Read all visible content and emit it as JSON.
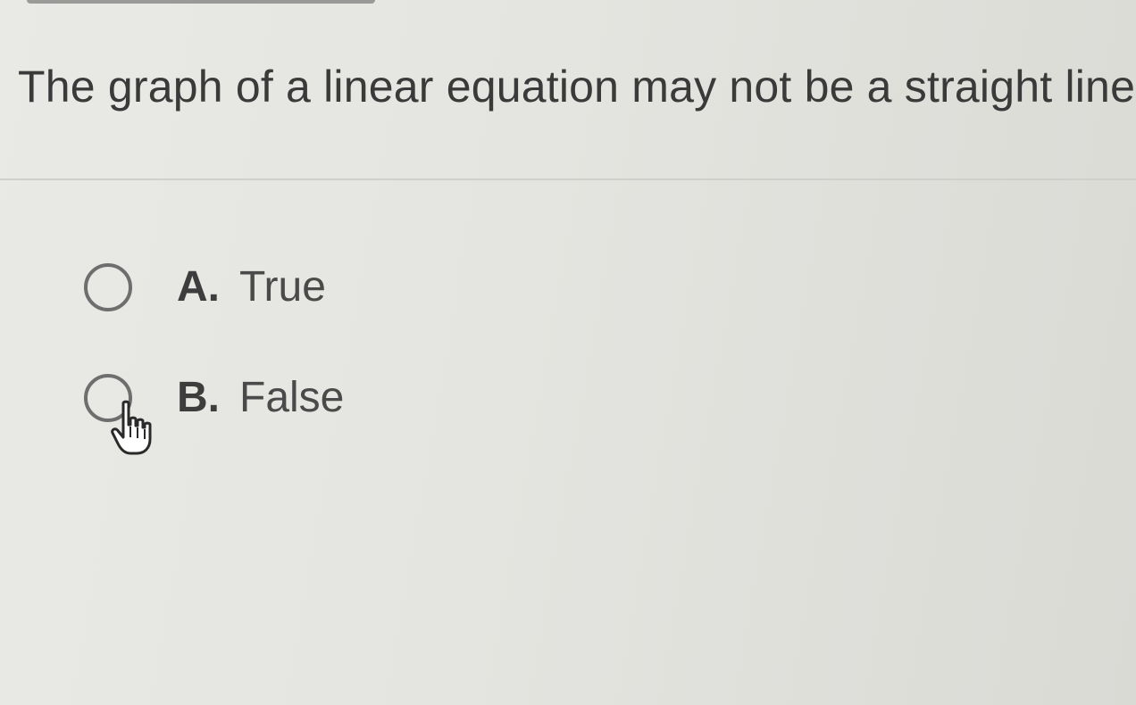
{
  "question": {
    "text": "The graph of a linear equation may not be a straight line"
  },
  "options": [
    {
      "letter": "A.",
      "label": "True",
      "selected": false
    },
    {
      "letter": "B.",
      "label": "False",
      "selected": false
    }
  ],
  "cursor": {
    "icon": "hand-pointer-icon"
  },
  "colors": {
    "background": "#e6e6e2",
    "text": "#3a3a3a",
    "radio_border": "#6e6e6e"
  }
}
